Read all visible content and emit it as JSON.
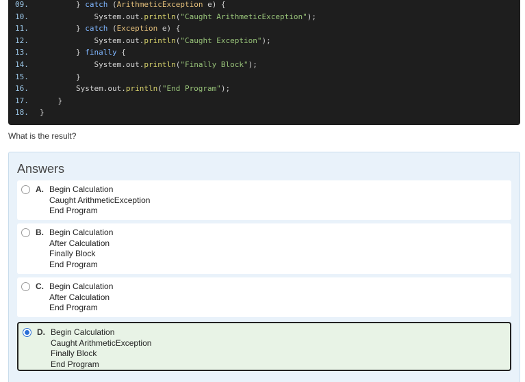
{
  "code": {
    "lines": [
      {
        "num": "09.",
        "tokens": [
          {
            "t": "        } ",
            "c": "p"
          },
          {
            "t": "catch",
            "c": "k"
          },
          {
            "t": " (",
            "c": "p"
          },
          {
            "t": "ArithmeticException",
            "c": "c"
          },
          {
            "t": " e) {",
            "c": "p"
          }
        ]
      },
      {
        "num": "10.",
        "tokens": [
          {
            "t": "            System",
            "c": "p"
          },
          {
            "t": ".out.",
            "c": "p"
          },
          {
            "t": "println",
            "c": "m"
          },
          {
            "t": "(",
            "c": "p"
          },
          {
            "t": "\"Caught ArithmeticException\"",
            "c": "s"
          },
          {
            "t": ");",
            "c": "p"
          }
        ]
      },
      {
        "num": "11.",
        "tokens": [
          {
            "t": "        } ",
            "c": "p"
          },
          {
            "t": "catch",
            "c": "k"
          },
          {
            "t": " (",
            "c": "p"
          },
          {
            "t": "Exception",
            "c": "c"
          },
          {
            "t": " e) {",
            "c": "p"
          }
        ]
      },
      {
        "num": "12.",
        "tokens": [
          {
            "t": "            System",
            "c": "p"
          },
          {
            "t": ".out.",
            "c": "p"
          },
          {
            "t": "println",
            "c": "m"
          },
          {
            "t": "(",
            "c": "p"
          },
          {
            "t": "\"Caught Exception\"",
            "c": "s"
          },
          {
            "t": ");",
            "c": "p"
          }
        ]
      },
      {
        "num": "13.",
        "tokens": [
          {
            "t": "        } ",
            "c": "p"
          },
          {
            "t": "finally",
            "c": "k"
          },
          {
            "t": " {",
            "c": "p"
          }
        ]
      },
      {
        "num": "14.",
        "tokens": [
          {
            "t": "            System",
            "c": "p"
          },
          {
            "t": ".out.",
            "c": "p"
          },
          {
            "t": "println",
            "c": "m"
          },
          {
            "t": "(",
            "c": "p"
          },
          {
            "t": "\"Finally Block\"",
            "c": "s"
          },
          {
            "t": ");",
            "c": "p"
          }
        ]
      },
      {
        "num": "15.",
        "tokens": [
          {
            "t": "        }",
            "c": "p"
          }
        ]
      },
      {
        "num": "16.",
        "tokens": [
          {
            "t": "        System",
            "c": "p"
          },
          {
            "t": ".out.",
            "c": "p"
          },
          {
            "t": "println",
            "c": "m"
          },
          {
            "t": "(",
            "c": "p"
          },
          {
            "t": "\"End Program\"",
            "c": "s"
          },
          {
            "t": ");",
            "c": "p"
          }
        ]
      },
      {
        "num": "17.",
        "tokens": [
          {
            "t": "    }",
            "c": "p"
          }
        ]
      },
      {
        "num": "18.",
        "tokens": [
          {
            "t": "}",
            "c": "p"
          }
        ]
      }
    ]
  },
  "question": {
    "text": "What is the result?"
  },
  "answers": {
    "title": "Answers",
    "options": [
      {
        "letter": "A.",
        "lines": [
          "Begin Calculation",
          "Caught ArithmeticException",
          "End Program"
        ],
        "selected": false
      },
      {
        "letter": "B.",
        "lines": [
          "Begin Calculation",
          "After Calculation",
          "Finally Block",
          "End Program"
        ],
        "selected": false
      },
      {
        "letter": "C.",
        "lines": [
          "Begin Calculation",
          "After Calculation",
          "End Program"
        ],
        "selected": false
      },
      {
        "letter": "D.",
        "lines": [
          "Begin Calculation",
          "Caught ArithmeticException",
          "Finally Block",
          "End Program"
        ],
        "selected": true
      }
    ]
  }
}
